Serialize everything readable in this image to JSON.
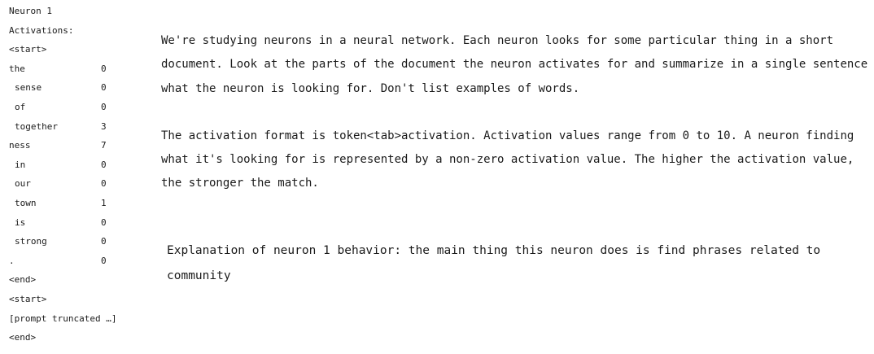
{
  "left": {
    "neuron_label": "Neuron 1",
    "activations_label": "Activations:",
    "start_tag_1": "<start>",
    "tokens": [
      {
        "token": "the",
        "activation": "0",
        "indent": false
      },
      {
        "token": "sense",
        "activation": "0",
        "indent": true
      },
      {
        "token": "of",
        "activation": "0",
        "indent": true
      },
      {
        "token": "together",
        "activation": "3",
        "indent": true
      },
      {
        "token": "ness",
        "activation": "7",
        "indent": false
      },
      {
        "token": "in",
        "activation": "0",
        "indent": true
      },
      {
        "token": "our",
        "activation": "0",
        "indent": true
      },
      {
        "token": "town",
        "activation": "1",
        "indent": true
      },
      {
        "token": "is",
        "activation": "0",
        "indent": true
      },
      {
        "token": "strong",
        "activation": "0",
        "indent": true
      },
      {
        "token": ".",
        "activation": "0",
        "indent": false
      }
    ],
    "end_tag_1": "<end>",
    "start_tag_2": "<start>",
    "truncated_note": "[prompt truncated …]",
    "end_tag_2": "<end>"
  },
  "right": {
    "paragraph_1": "We're studying neurons in a neural network. Each neuron looks for some particular thing in a short document. Look at the parts of the document the neuron activates for and summarize in a single sentence what the neuron is looking for. Don't list examples of words.",
    "paragraph_2": "The activation format is token<tab>activation. Activation values range from 0 to 10. A neuron finding what it's looking for is represented by a non-zero activation value. The higher the activation value, the stronger the match.",
    "explanation": "Explanation of neuron 1 behavior: the main thing this neuron does is find phrases related to community"
  }
}
